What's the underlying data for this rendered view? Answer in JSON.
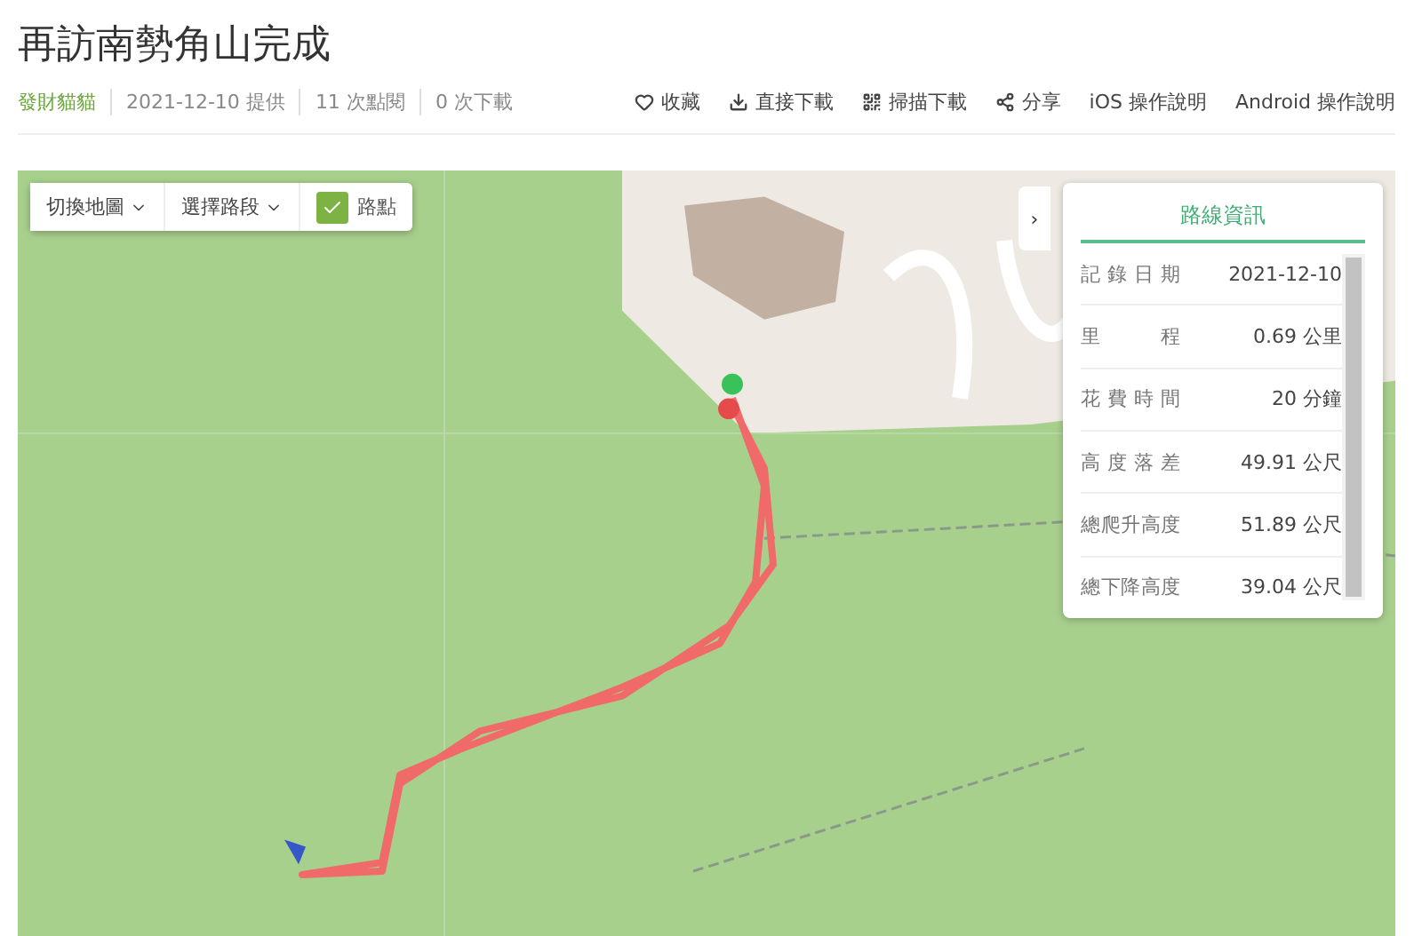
{
  "title": "再訪南勢角山完成",
  "meta": {
    "author": "發財貓貓",
    "items": [
      "2021-12-10 提供",
      "11 次點閱",
      "0 次下載"
    ]
  },
  "actions": [
    {
      "kind": "heart",
      "label": "收藏"
    },
    {
      "kind": "download",
      "label": "直接下載"
    },
    {
      "kind": "qr",
      "label": "掃描下載"
    },
    {
      "kind": "share",
      "label": "分享"
    },
    {
      "kind": "text",
      "label": "iOS 操作說明"
    },
    {
      "kind": "text",
      "label": "Android 操作說明"
    }
  ],
  "map_toolbar": {
    "dropdowns": [
      "切換地圖",
      "選擇路段"
    ],
    "waypoints": {
      "label": "路點",
      "checked": true
    }
  },
  "panel": {
    "toggle": "›",
    "title": "路線資訊",
    "rows": [
      {
        "label": "記錄日期",
        "value": "2021-12-10"
      },
      {
        "label": "里程",
        "value": "0.69 公里"
      },
      {
        "label": "花費時間",
        "value": "20 分鐘"
      },
      {
        "label": "高度落差",
        "value": "49.91 公尺"
      },
      {
        "label": "總爬升高度",
        "value": "51.89 公尺"
      },
      {
        "label": "總下降高度",
        "value": "39.04 公尺"
      }
    ]
  }
}
